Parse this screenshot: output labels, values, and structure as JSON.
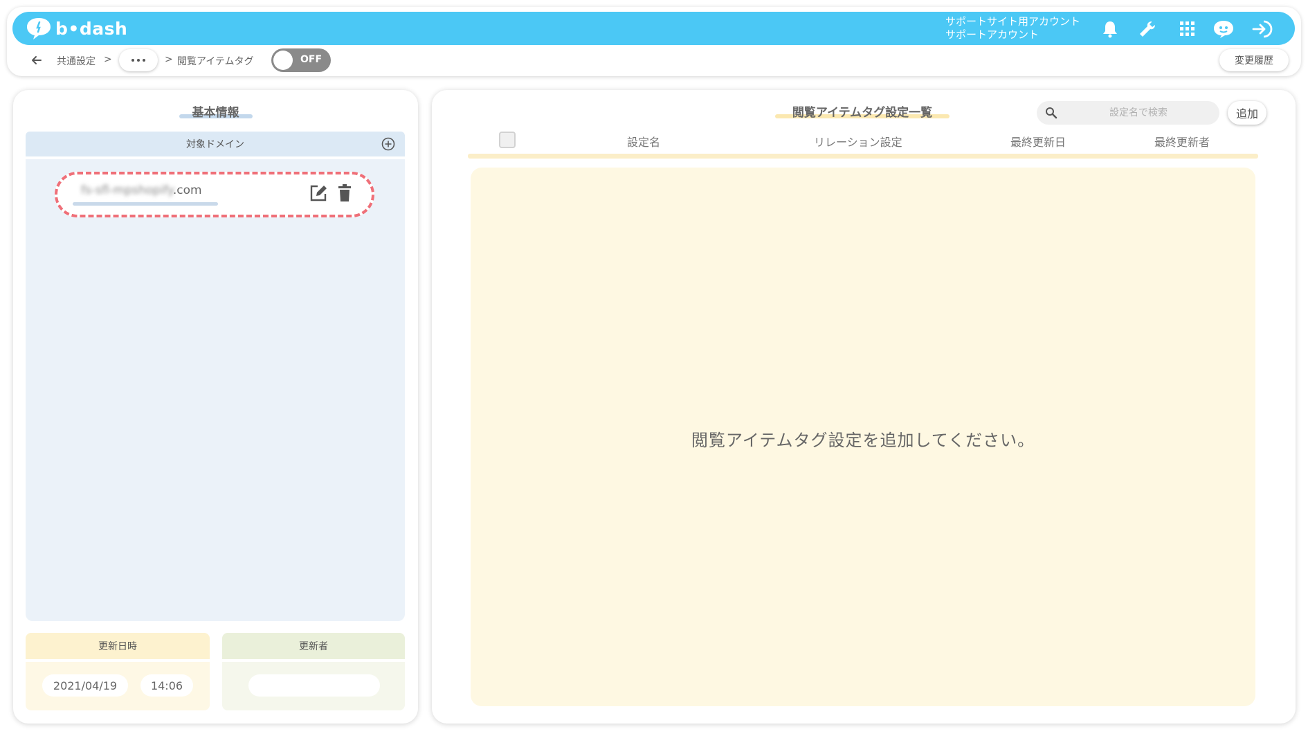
{
  "header": {
    "logo_text": "b•dash",
    "account_line1": "サポートサイト用アカウント",
    "account_line2": "サポートアカウント",
    "bar_color": "#4bc8f5"
  },
  "nav": {
    "breadcrumb_common": "共通設定",
    "separator1": ">",
    "separator2": ">",
    "page_name": "閲覧アイテムタグ",
    "toggle_label": "OFF",
    "history_button": "変更履歴"
  },
  "left": {
    "title": "基本情報",
    "domain_header": "対象ドメイン",
    "domain_blurred": "fs-sfl-mpshopify",
    "domain_suffix": ".com",
    "updated_at_label": "更新日時",
    "updater_label": "更新者",
    "updated_date": "2021/04/19",
    "updated_time": "14:06"
  },
  "right": {
    "title": "閲覧アイテムタグ設定一覧",
    "search_placeholder": "設定名で検索",
    "add_button": "追加",
    "columns": [
      "設定名",
      "リレーション設定",
      "最終更新日",
      "最終更新者"
    ],
    "empty_message": "閲覧アイテムタグ設定を追加してください。"
  }
}
